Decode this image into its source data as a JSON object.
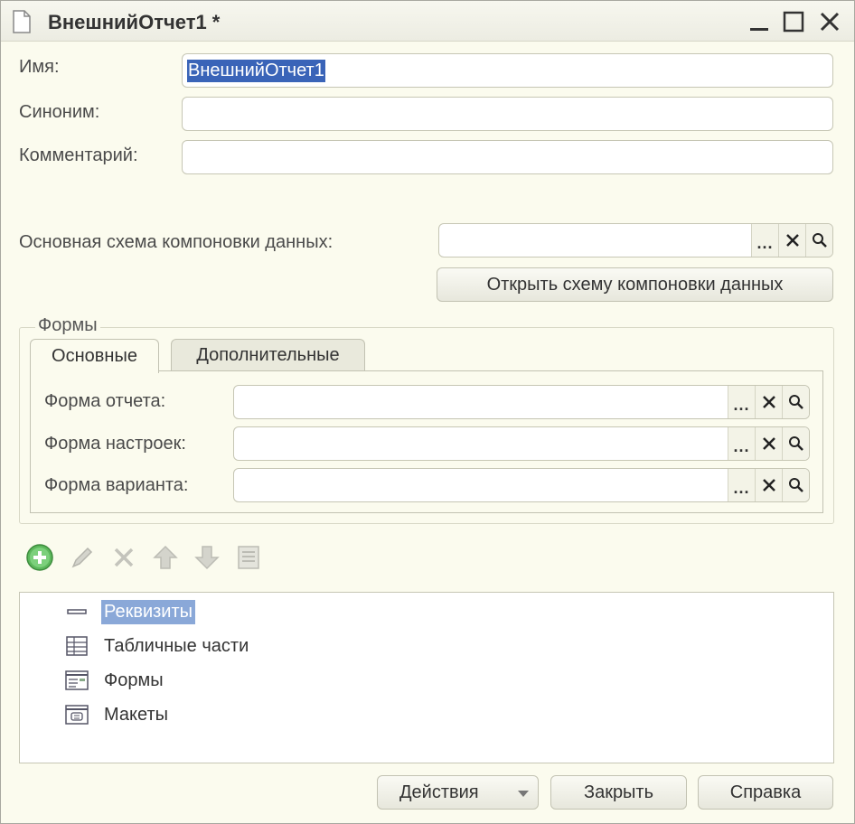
{
  "window": {
    "title": "ВнешнийОтчет1 *"
  },
  "fields": {
    "name_label": "Имя:",
    "name_value": "ВнешнийОтчет1",
    "synonym_label": "Синоним:",
    "synonym_value": "",
    "comment_label": "Комментарий:",
    "comment_value": "",
    "schema_label": "Основная схема компоновки данных:",
    "schema_value": "",
    "open_schema_button": "Открыть схему компоновки данных"
  },
  "forms_group": {
    "legend": "Формы",
    "tabs": [
      {
        "label": "Основные",
        "active": true
      },
      {
        "label": "Дополнительные",
        "active": false
      }
    ],
    "rows": [
      {
        "label": "Форма отчета:",
        "value": ""
      },
      {
        "label": "Форма настроек:",
        "value": ""
      },
      {
        "label": "Форма варианта:",
        "value": ""
      }
    ],
    "ref_buttons": {
      "dots": "...",
      "clear": "✕",
      "search": "search-icon"
    }
  },
  "toolbar": {
    "icons": [
      "add-icon",
      "edit-icon",
      "delete-icon",
      "move-up-icon",
      "move-down-icon",
      "list-icon"
    ]
  },
  "tree": {
    "items": [
      {
        "label": "Реквизиты",
        "icon": "attribute-icon",
        "selected": true
      },
      {
        "label": "Табличные части",
        "icon": "table-icon",
        "selected": false
      },
      {
        "label": "Формы",
        "icon": "form-icon",
        "selected": false
      },
      {
        "label": "Макеты",
        "icon": "template-icon",
        "selected": false
      }
    ]
  },
  "buttons": {
    "actions": "Действия",
    "close": "Закрыть",
    "help": "Справка"
  },
  "colors": {
    "background": "#fbfbee",
    "selection": "#3a64b8",
    "tree_selection": "#8aa8d8",
    "add_icon": "#4caf50"
  }
}
